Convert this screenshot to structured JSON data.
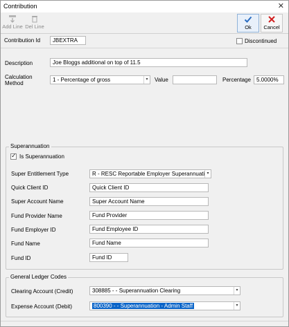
{
  "window": {
    "title": "Contribution",
    "close_glyph": "✕"
  },
  "toolbar": {
    "add_line": "Add Line",
    "del_line": "Del Line",
    "ok": "Ok",
    "cancel": "Cancel"
  },
  "header": {
    "contribution_id_label": "Contribution Id",
    "contribution_id_value": "JBEXTRA",
    "discontinued_label": "Discontinued"
  },
  "details": {
    "description_label": "Description",
    "description_value": "Joe Bloggs additional on top of 11.5",
    "calc_method_label": "Calculation\nMethod",
    "calc_method_value": "1 -  Percentage of gross",
    "value_label": "Value",
    "value_value": "",
    "percentage_label": "Percentage",
    "percentage_value": "5.0000%"
  },
  "superannuation": {
    "group_title": "Superannuation",
    "is_super_label": "Is Superannuation",
    "is_super_checked": true,
    "fields": [
      {
        "label": "Super Entitlement Type",
        "value": "R - RESC Reportable Employer Superannuation"
      },
      {
        "label": "Quick Client ID",
        "value": "Quick Client ID"
      },
      {
        "label": "Super Account Name",
        "value": "Super Account Name"
      },
      {
        "label": "Fund Provider Name",
        "value": "Fund Provider"
      },
      {
        "label": "Fund Employer ID",
        "value": "Fund Employee ID"
      },
      {
        "label": "Fund Name",
        "value": "Fund Name"
      },
      {
        "label": "Fund ID",
        "value": "Fund ID"
      }
    ]
  },
  "gl_codes": {
    "group_title": "General Ledger Codes",
    "clearing_label": "Clearing Account (Credit)",
    "clearing_value": "308885 -  - Superannuation Clearing",
    "expense_label": "Expense Account (Debit)",
    "expense_value": "800390 -  - Superannuation - Admin Staff"
  },
  "colors": {
    "accent": "#0a64c8",
    "ok_icon": "#2a6cc0",
    "cancel_icon": "#d01f1f"
  }
}
